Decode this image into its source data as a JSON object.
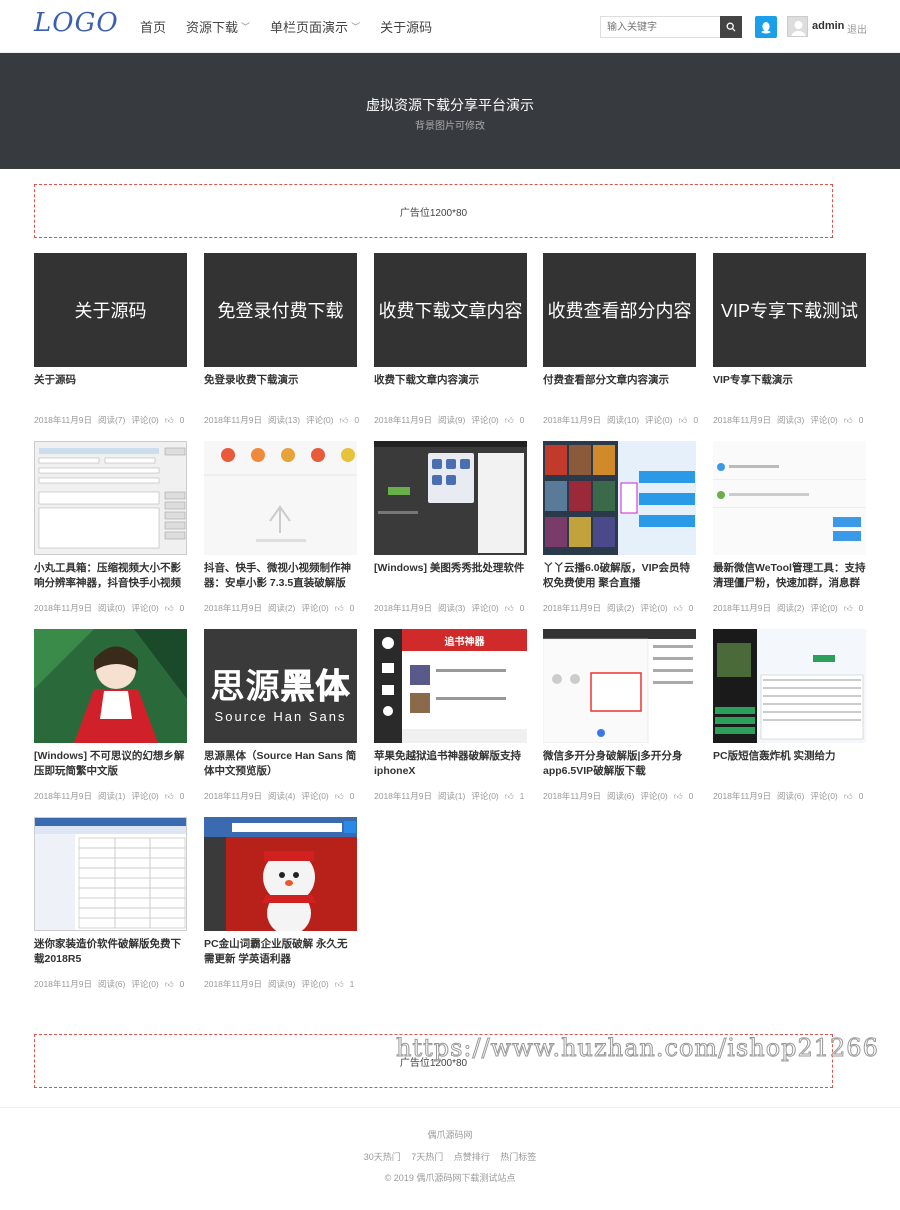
{
  "header": {
    "logo": "LOGO",
    "nav": [
      {
        "label": "首页",
        "has_dropdown": false
      },
      {
        "label": "资源下载",
        "has_dropdown": true
      },
      {
        "label": "单栏页面演示",
        "has_dropdown": true
      },
      {
        "label": "关于源码",
        "has_dropdown": false
      }
    ],
    "search_placeholder": "输入关键字",
    "username": "admin",
    "logout": "退出"
  },
  "banner": {
    "title": "虚拟资源下载分享平台演示",
    "subtitle": "背景图片可修改"
  },
  "ads": {
    "top": "广告位1200*80",
    "bottom": "广告位1200*80"
  },
  "watermark": "https://www.huzhan.com/ishop21266",
  "posts": [
    {
      "thumb_text": "关于源码",
      "title": "关于源码",
      "date": "2018年11月9日",
      "views": "阅读(7)",
      "comments": "评论(0)",
      "likes": "0"
    },
    {
      "thumb_text": "免登录付费下载",
      "title": "免登录收费下载演示",
      "date": "2018年11月9日",
      "views": "阅读(13)",
      "comments": "评论(0)",
      "likes": "0"
    },
    {
      "thumb_text": "收费下载文章内容",
      "title": "收费下载文章内容演示",
      "date": "2018年11月9日",
      "views": "阅读(9)",
      "comments": "评论(0)",
      "likes": "0"
    },
    {
      "thumb_text": "收费查看部分内容",
      "title": "付费查看部分文章内容演示",
      "date": "2018年11月9日",
      "views": "阅读(10)",
      "comments": "评论(0)",
      "likes": "0"
    },
    {
      "thumb_text": "VIP专享下载测试",
      "title": "VIP专享下载演示",
      "date": "2018年11月9日",
      "views": "阅读(3)",
      "comments": "评论(0)",
      "likes": "0"
    },
    {
      "thumb_text": "",
      "title": "小丸工具箱：压缩视频大小不影响分辨率神器，抖音快手小视频制作",
      "date": "2018年11月9日",
      "views": "阅读(0)",
      "comments": "评论(0)",
      "likes": "0"
    },
    {
      "thumb_text": "",
      "title": "抖音、快手、微视小视频制作神器：安卓小影 7.3.5直装破解版",
      "date": "2018年11月9日",
      "views": "阅读(2)",
      "comments": "评论(0)",
      "likes": "0"
    },
    {
      "thumb_text": "",
      "title": "[Windows] 美图秀秀批处理软件",
      "date": "2018年11月9日",
      "views": "阅读(3)",
      "comments": "评论(0)",
      "likes": "0"
    },
    {
      "thumb_text": "",
      "title": "丫丫云播6.0破解版，VIP会员特权免费使用 聚合直播",
      "date": "2018年11月9日",
      "views": "阅读(2)",
      "comments": "评论(0)",
      "likes": "0"
    },
    {
      "thumb_text": "",
      "title": "最新微信WeTool管理工具：支持清理僵尸粉，快速加群，消息群发",
      "date": "2018年11月9日",
      "views": "阅读(2)",
      "comments": "评论(0)",
      "likes": "0"
    },
    {
      "thumb_text": "",
      "title": "[Windows] 不可思议的幻想乡解压即玩简繁中文版",
      "date": "2018年11月9日",
      "views": "阅读(1)",
      "comments": "评论(0)",
      "likes": "0"
    },
    {
      "thumb_text": "思源黑体",
      "title": "思源黑体（Source Han Sans 简体中文预览版）",
      "date": "2018年11月9日",
      "views": "阅读(4)",
      "comments": "评论(0)",
      "likes": "0"
    },
    {
      "thumb_text": "",
      "title": "苹果免越狱追书神器破解版支持iphoneX",
      "date": "2018年11月9日",
      "views": "阅读(1)",
      "comments": "评论(0)",
      "likes": "1"
    },
    {
      "thumb_text": "",
      "title": "微信多开分身破解版|多开分身app6.5VIP破解版下载",
      "date": "2018年11月9日",
      "views": "阅读(6)",
      "comments": "评论(0)",
      "likes": "0"
    },
    {
      "thumb_text": "",
      "title": "PC版短信轰炸机 实测给力",
      "date": "2018年11月9日",
      "views": "阅读(6)",
      "comments": "评论(0)",
      "likes": "0"
    },
    {
      "thumb_text": "",
      "title": "迷你家装造价软件破解版免费下载2018R5",
      "date": "2018年11月9日",
      "views": "阅读(6)",
      "comments": "评论(0)",
      "likes": "0"
    },
    {
      "thumb_text": "",
      "title": "PC金山词霸企业版破解 永久无需更新 学英语利器",
      "date": "2018年11月9日",
      "views": "阅读(9)",
      "comments": "评论(0)",
      "likes": "1"
    }
  ],
  "thumb_extras": {
    "source_han": "Source Han Sans",
    "source_han_a": "思源",
    "source_han_b": "黑体",
    "novel_app": "追书神器"
  },
  "footer": {
    "site": "偶爪源码网",
    "links": [
      "30天热门",
      "7天热门",
      "点赞排行",
      "热门标签"
    ],
    "copyright": "© 2019 偶爪源码网下载测试站点"
  },
  "colors": {
    "banner_bg": "#373a3f",
    "ad_border": "#d9534f",
    "qq_blue": "#1aa0e8",
    "logo_blue": "#3a5fb0"
  }
}
